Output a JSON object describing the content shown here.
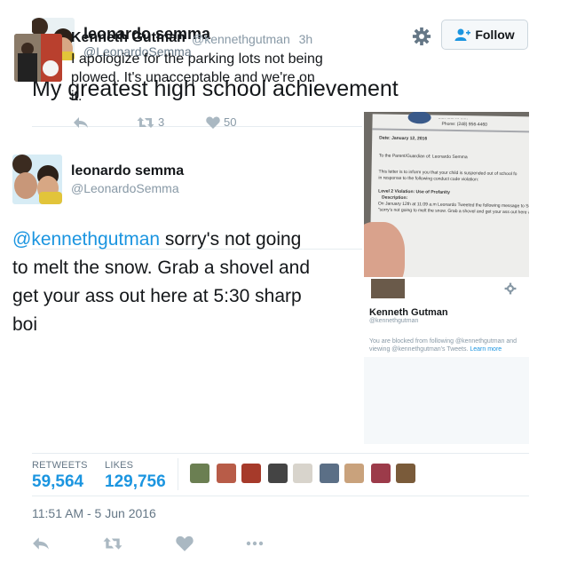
{
  "tweet": {
    "author_name": "leonardo semma",
    "author_handle": "@LeonardoSemma",
    "follow_label": "Follow",
    "text": "My greatest high school achievement",
    "timestamp": "11:51 AM - 5 Jun 2016"
  },
  "stats": {
    "retweets_label": "RETWEETS",
    "retweets_value": "59,564",
    "likes_label": "LIKES",
    "likes_value": "129,756"
  },
  "embedded": {
    "original": {
      "name": "Kenneth Gutman",
      "handle": "@kennethgutman",
      "time": "3h",
      "text": "I apologize for the parking lots not being plowed. It's unacceptable and we're on it.",
      "retweets": "3",
      "likes": "50"
    },
    "reply": {
      "name": "leonardo semma",
      "handle": "@LeonardoSemma",
      "mention": "@kennethgutman",
      "text": " sorry's not going to melt the snow. Grab a shovel and get your ass out here at 5:30 sharp boi"
    }
  },
  "letter": {
    "address": "...... ...... ... ......",
    "phone": "Phone: (248) 956-4460",
    "date": "Date: January 12, 2016",
    "to": "To the Parent/Guardian of: Leonardo Semma",
    "body1": "This letter is to inform you that your child is suspended out of school fo",
    "body2": "in response to the following conduct code violation:",
    "level": "Level 2       Violation: Use of Profanity",
    "desc": "Description:",
    "line1": "On January 12th at 11:09 a.m Leonardo Tweeted the following message to Supe",
    "line2": "\"sorry's not going to melt the snow.  Grab a shovel and get your ass out here at"
  },
  "profile_snippet": {
    "name": "Kenneth Gutman",
    "handle": "@kennethgutman",
    "blocked_text": "You are blocked from following @kennethgutman and viewing @kennethgutman's Tweets. ",
    "learn_more": "Learn more"
  },
  "icons": [
    "gear-icon",
    "follow-user-icon",
    "reply-icon",
    "retweet-icon",
    "like-icon",
    "more-icon"
  ],
  "colors": {
    "link": "#1b95e0",
    "text": "#14171a",
    "muted": "#657786",
    "border": "#e6ecf0"
  }
}
